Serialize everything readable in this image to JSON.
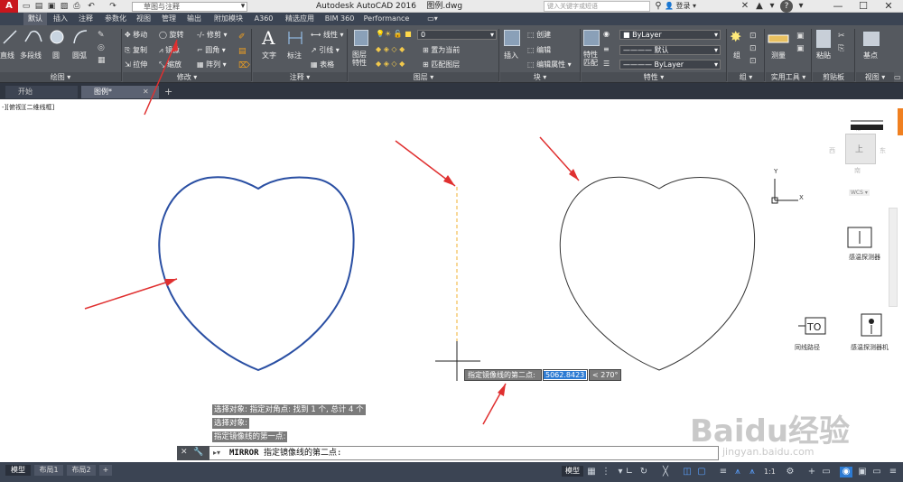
{
  "titlebar": {
    "logo": "A",
    "workspace": "草图与注释",
    "app_title": "Autodesk AutoCAD 2016",
    "file_name": "图例.dwg",
    "search_placeholder": "键入关键字或短语",
    "login": "登录",
    "help": "?"
  },
  "tabs": [
    "默认",
    "插入",
    "注释",
    "参数化",
    "视图",
    "管理",
    "输出",
    "附加模块",
    "A360",
    "精选应用",
    "BIM 360",
    "Performance"
  ],
  "ribbon": {
    "draw": {
      "line": "直线",
      "polyline": "多段线",
      "circle": "圆",
      "arc": "圆弧",
      "panel": "绘图 ▾"
    },
    "modify": {
      "move": "移动",
      "rotate": "旋转",
      "trim": "修剪 ▾",
      "copy": "复制",
      "mirror": "镜像",
      "fillet": "圆角 ▾",
      "stretch": "拉伸",
      "scale": "缩放",
      "array": "阵列 ▾",
      "panel": "修改 ▾"
    },
    "annotation": {
      "text": "文字",
      "dimension": "标注",
      "linear": "线性 ▾",
      "leader": "引线 ▾",
      "table": "表格",
      "panel": "注释 ▾"
    },
    "layers": {
      "layer_props": "图层\n特性",
      "current_layer": "0",
      "set_current": "置为当前",
      "match_layer": "匹配图层",
      "panel": "图层 ▾"
    },
    "block": {
      "insert": "插入",
      "create": "创建",
      "edit": "编辑",
      "edit_attr": "编辑属性 ▾",
      "panel": "块 ▾"
    },
    "properties": {
      "match": "特性\n匹配",
      "color": "ByLayer",
      "linetype": "———— 默认",
      "lineweight": "———— ByLayer",
      "panel": "特性 ▾"
    },
    "groups": {
      "group": "组",
      "panel": "组 ▾"
    },
    "utilities": {
      "measure": "测量",
      "panel": "实用工具 ▾"
    },
    "clipboard": {
      "paste": "粘贴",
      "panel": "剪贴板"
    },
    "view": {
      "base": "基点",
      "panel": "视图 ▾"
    }
  },
  "doc_tabs": [
    "开始",
    "图例*"
  ],
  "viewport_label": "-][俯视][二维线框]",
  "viewcube": {
    "north": "北",
    "south": "南",
    "east": "东",
    "west": "西",
    "top": "上",
    "wcs": "WCS ▾"
  },
  "ucs": {
    "x": "X",
    "y": "Y"
  },
  "blocks": {
    "sensor": "感温探测器",
    "wire": "同线路径",
    "detector": "感温探测器机"
  },
  "history": [
    "选择对象: 指定对角点: 找到 1 个, 总计 4 个",
    "选择对象:",
    "指定镜像线的第一点:"
  ],
  "command": {
    "name": "MIRROR",
    "prompt": "指定镜像线的第二点:"
  },
  "dyn_input": {
    "prompt": "指定镜像线的第二点:",
    "value": "5062.8423",
    "angle": "< 270°"
  },
  "layouts": [
    "模型",
    "布局1",
    "布局2"
  ],
  "status": {
    "model": "模型",
    "scale": "1:1"
  },
  "watermark": {
    "brand": "Baidu经验",
    "url": "jingyan.baidu.com"
  },
  "colors": {
    "selected": "#2a4fa3",
    "mirror_line": "#f0b030",
    "arrow": "#e03030",
    "ribbon": "#55595f"
  }
}
